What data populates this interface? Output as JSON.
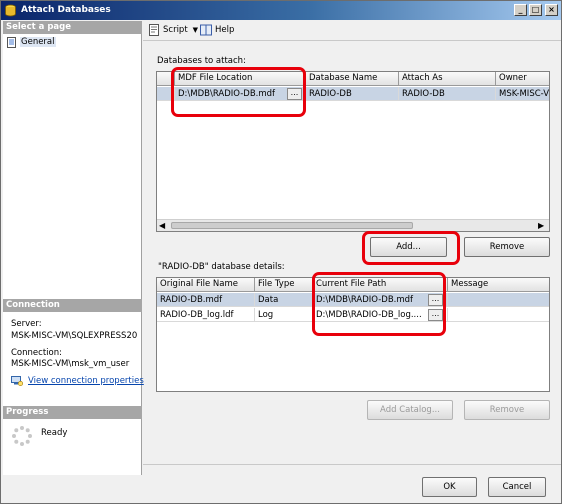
{
  "window": {
    "title": "Attach Databases"
  },
  "left_pane": {
    "select_page_header": "Select a page",
    "pages": [
      "General"
    ],
    "connection_header": "Connection",
    "server_label": "Server:",
    "server_value": "MSK-MISC-VM\\SQLEXPRESS20",
    "connection_label": "Connection:",
    "connection_value": "MSK-MISC-VM\\msk_vm_user",
    "view_connection_link": "View connection properties",
    "progress_header": "Progress",
    "progress_status": "Ready"
  },
  "toolbar": {
    "script_label": "Script",
    "help_label": "Help"
  },
  "databases": {
    "label": "Databases to attach:",
    "columns": [
      "MDF File Location",
      "Database Name",
      "Attach As",
      "Owner"
    ],
    "rows": [
      {
        "mdf": "D:\\MDB\\RADIO-DB.mdf",
        "db_name": "RADIO-DB",
        "attach_as": "RADIO-DB",
        "owner": "MSK-MISC-V"
      }
    ],
    "add_button": "Add...",
    "remove_button": "Remove"
  },
  "details": {
    "label": "\"RADIO-DB\" database details:",
    "columns": [
      "Original File Name",
      "File Type",
      "Current File Path",
      "Message"
    ],
    "rows": [
      {
        "name": "RADIO-DB.mdf",
        "type": "Data",
        "path": "D:\\MDB\\RADIO-DB.mdf",
        "message": ""
      },
      {
        "name": "RADIO-DB_log.ldf",
        "type": "Log",
        "path": "D:\\MDB\\RADIO-DB_log....",
        "message": ""
      }
    ],
    "add_catalog_button": "Add Catalog...",
    "remove_button": "Remove"
  },
  "footer": {
    "ok_button": "OK",
    "cancel_button": "Cancel"
  },
  "dots_label": "...",
  "colors": {
    "highlight": "#e8000b",
    "title_bar": "#0a246a",
    "selected_row": "#c8d4e4"
  }
}
